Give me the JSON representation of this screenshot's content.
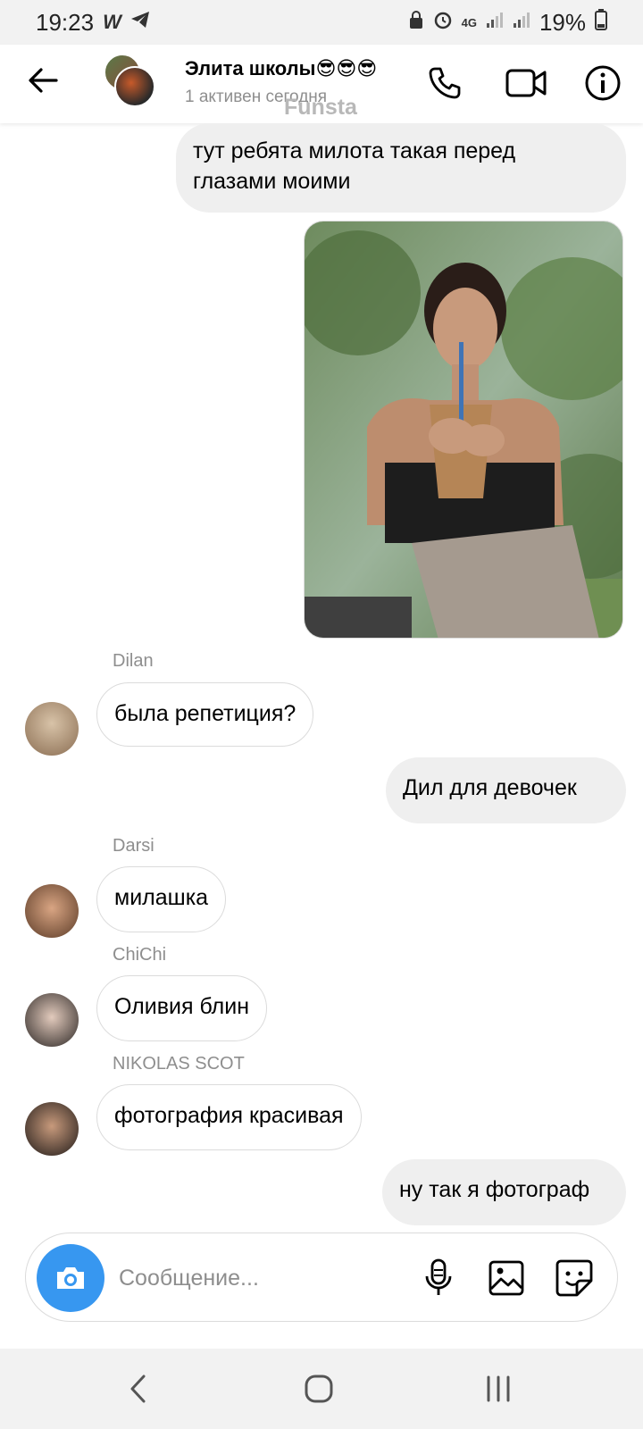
{
  "status_bar": {
    "time": "19:23",
    "battery": "19%",
    "network": "4G"
  },
  "header": {
    "title": "Элита школы😎😎😎",
    "subtitle": "1 активен сегодня",
    "overlay_text": "Funsta"
  },
  "messages": [
    {
      "type": "out",
      "text_line1": "тут ребята милота такая перед",
      "text_line2": "глазами моими"
    },
    {
      "type": "out-photo"
    },
    {
      "type": "in",
      "sender": "Dilan",
      "text": "была репетиция?"
    },
    {
      "type": "out",
      "text": "Дил для девочек"
    },
    {
      "type": "in",
      "sender": "Darsi",
      "text": "милашка"
    },
    {
      "type": "in",
      "sender": "ChiChi",
      "text": "Оливия блин"
    },
    {
      "type": "in",
      "sender": "NIKOLAS SCOT",
      "text": "фотография красивая"
    },
    {
      "type": "out",
      "text": "ну так я фотограф"
    }
  ],
  "composer": {
    "placeholder": "Сообщение..."
  },
  "icons": {
    "back": "back-arrow-icon",
    "call": "phone-icon",
    "video": "video-camera-icon",
    "info": "info-icon",
    "camera": "camera-icon",
    "mic": "microphone-icon",
    "gallery": "image-icon",
    "sticker": "sticker-icon"
  },
  "colors": {
    "accent": "#3797f0",
    "outgoing_bubble": "#efefef",
    "muted_text": "#8e8e8e"
  }
}
